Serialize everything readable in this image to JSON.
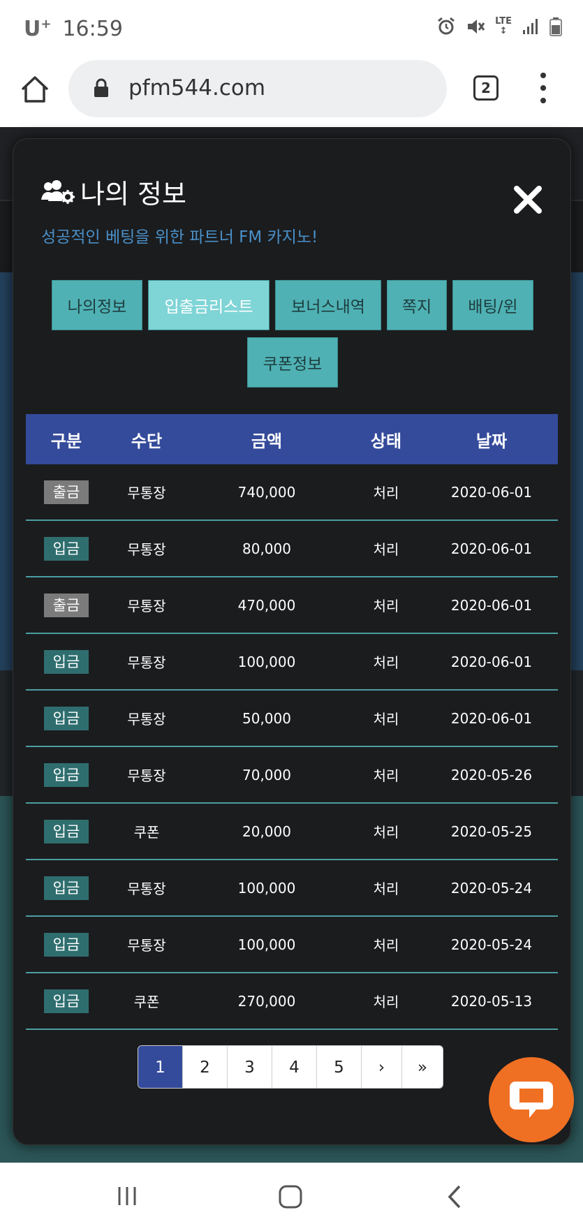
{
  "status_bar": {
    "carrier": "U",
    "carrier_sup": "+",
    "time": "16:59",
    "lte": "LTE"
  },
  "browser": {
    "url": "pfm544.com",
    "tab_count": "2"
  },
  "modal": {
    "title": "나의 정보",
    "subtitle": "성공적인 베팅을 위한 파트너 FM 카지노!",
    "tabs": [
      {
        "label": "나의정보"
      },
      {
        "label": "입출금리스트"
      },
      {
        "label": "보너스내역"
      },
      {
        "label": "쪽지"
      },
      {
        "label": "배팅/윈"
      },
      {
        "label": "쿠폰정보"
      }
    ],
    "active_tab": "입출금리스트",
    "table": {
      "headers": [
        "구분",
        "수단",
        "금액",
        "상태",
        "날짜"
      ],
      "rows": [
        {
          "type": "출금",
          "method": "무통장",
          "amount": "740,000",
          "status": "처리",
          "date": "2020-06-01"
        },
        {
          "type": "입금",
          "method": "무통장",
          "amount": "80,000",
          "status": "처리",
          "date": "2020-06-01"
        },
        {
          "type": "출금",
          "method": "무통장",
          "amount": "470,000",
          "status": "처리",
          "date": "2020-06-01"
        },
        {
          "type": "입금",
          "method": "무통장",
          "amount": "100,000",
          "status": "처리",
          "date": "2020-06-01"
        },
        {
          "type": "입금",
          "method": "무통장",
          "amount": "50,000",
          "status": "처리",
          "date": "2020-06-01"
        },
        {
          "type": "입금",
          "method": "무통장",
          "amount": "70,000",
          "status": "처리",
          "date": "2020-05-26"
        },
        {
          "type": "입금",
          "method": "쿠폰",
          "amount": "20,000",
          "status": "처리",
          "date": "2020-05-25"
        },
        {
          "type": "입금",
          "method": "무통장",
          "amount": "100,000",
          "status": "처리",
          "date": "2020-05-24"
        },
        {
          "type": "입금",
          "method": "무통장",
          "amount": "100,000",
          "status": "처리",
          "date": "2020-05-24"
        },
        {
          "type": "입금",
          "method": "쿠폰",
          "amount": "270,000",
          "status": "처리",
          "date": "2020-05-13"
        }
      ]
    },
    "pagination": [
      "1",
      "2",
      "3",
      "4",
      "5",
      "›",
      "»"
    ],
    "current_page": "1"
  },
  "colors": {
    "header_blue": "#344b9b",
    "tab_teal": "#4fb1b4",
    "tab_active": "#7fd4d6",
    "subtitle_blue": "#4a90c8",
    "chat_orange": "#f07023",
    "badge_withdraw": "#7b7b7b",
    "badge_deposit": "#2f6e6f"
  }
}
